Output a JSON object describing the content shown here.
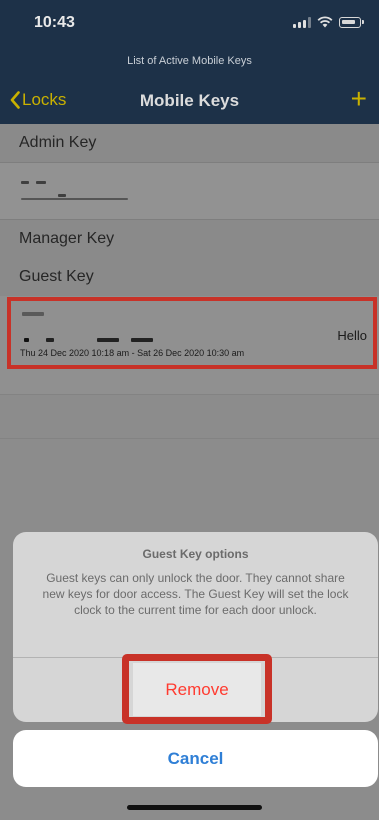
{
  "status": {
    "time": "10:43"
  },
  "header": {
    "subtitle": "List of Active Mobile Keys",
    "back_label": "Locks",
    "title": "Mobile Keys",
    "add_label": "+"
  },
  "sections": {
    "admin": "Admin Key",
    "manager": "Manager Key",
    "guest": "Guest Key"
  },
  "guest_key": {
    "name": "Hello",
    "validity": "Thu 24 Dec 2020 10:18 am - Sat 26 Dec 2020 10:30 am"
  },
  "action_sheet": {
    "title": "Guest Key options",
    "message": "Guest keys can only unlock the door. They cannot share new keys for door access. The Guest Key will set the lock clock to the current time for each door unlock.",
    "remove_label": "Remove",
    "cancel_label": "Cancel"
  },
  "colors": {
    "accent_yellow": "#c9b100",
    "destructive_red": "#ff3b30",
    "cancel_blue": "#2f7fd6",
    "highlight_red": "#c83228",
    "header_navy": "#1d3148"
  }
}
